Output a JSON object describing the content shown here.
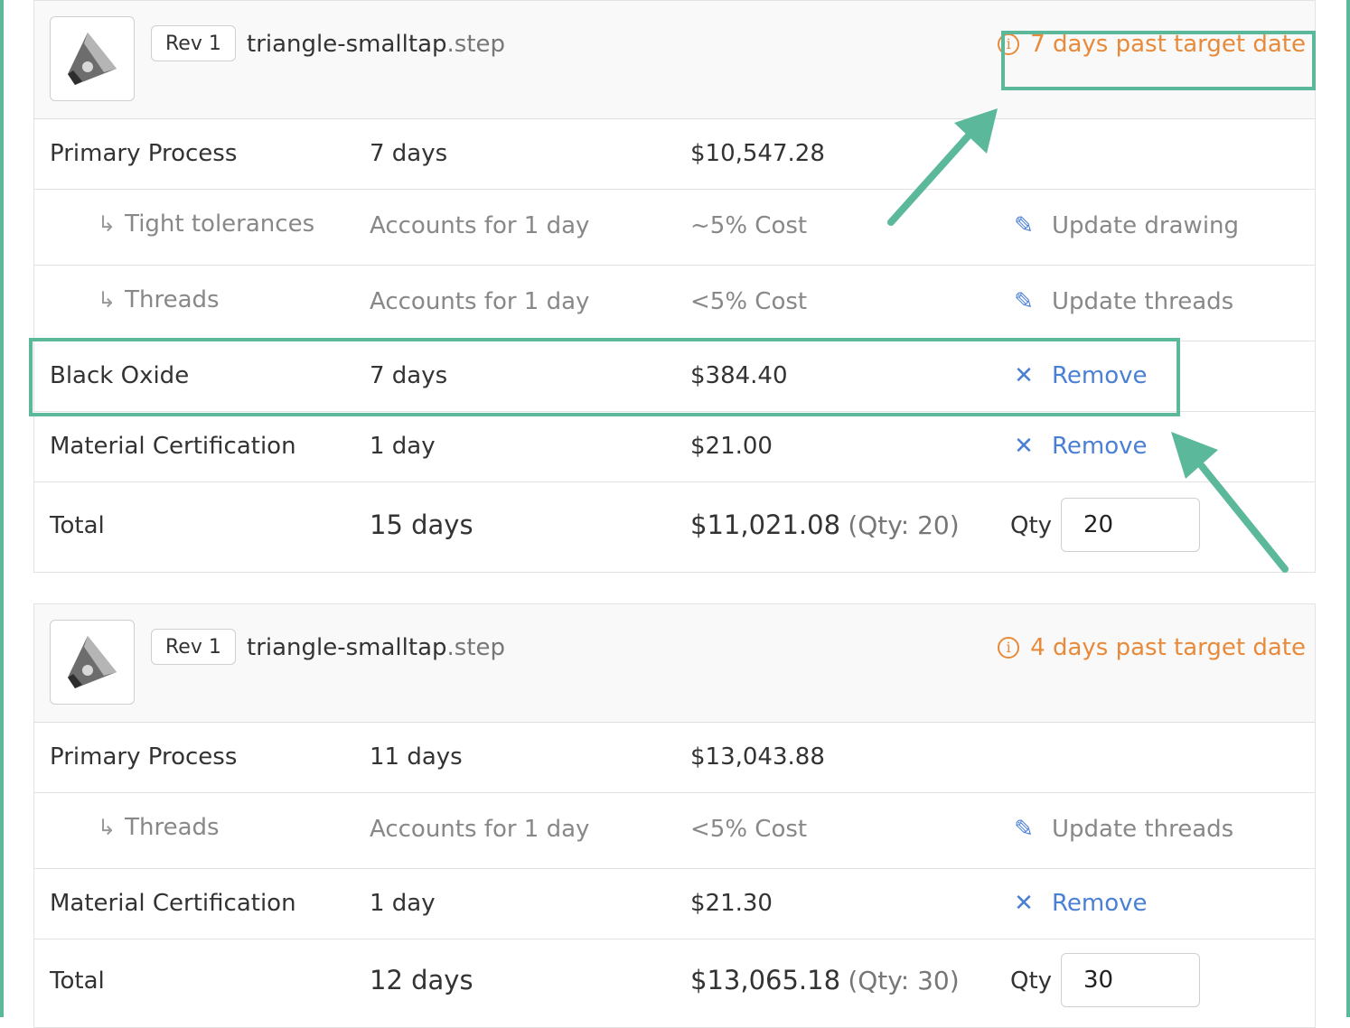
{
  "colors": {
    "accent": "#5bb89a",
    "warning": "#e98a3a",
    "link": "#4a7fd6"
  },
  "parts": [
    {
      "rev": "Rev 1",
      "filename_base": "triangle-smalltap",
      "filename_ext": ".step",
      "warning": "7 days past target date",
      "primary": {
        "label": "Primary Process",
        "days": "7 days",
        "cost": "$10,547.28"
      },
      "subs": [
        {
          "label": "Tight tolerances",
          "days": "Accounts for 1 day",
          "cost": "~5% Cost",
          "action": "Update drawing"
        },
        {
          "label": "Threads",
          "days": "Accounts for 1 day",
          "cost": "<5% Cost",
          "action": "Update threads"
        }
      ],
      "extras": [
        {
          "label": "Black Oxide",
          "days": "7 days",
          "cost": "$384.40",
          "action": "Remove"
        },
        {
          "label": "Material Certification",
          "days": "1 day",
          "cost": "$21.00",
          "action": "Remove"
        }
      ],
      "total": {
        "label": "Total",
        "days": "15 days",
        "cost": "$11,021.08",
        "qty_note": "(Qty: 20)",
        "qty_label": "Qty",
        "qty_value": "20"
      }
    },
    {
      "rev": "Rev 1",
      "filename_base": "triangle-smalltap",
      "filename_ext": ".step",
      "warning": "4 days past target date",
      "primary": {
        "label": "Primary Process",
        "days": "11 days",
        "cost": "$13,043.88"
      },
      "subs": [
        {
          "label": "Threads",
          "days": "Accounts for 1 day",
          "cost": "<5% Cost",
          "action": "Update threads"
        }
      ],
      "extras": [
        {
          "label": "Material Certification",
          "days": "1 day",
          "cost": "$21.30",
          "action": "Remove"
        }
      ],
      "total": {
        "label": "Total",
        "days": "12 days",
        "cost": "$13,065.18",
        "qty_note": "(Qty: 30)",
        "qty_label": "Qty",
        "qty_value": "30"
      }
    }
  ],
  "icons": {
    "sub": "sub-arrow-icon",
    "edit": "pencil-icon",
    "remove": "close-icon",
    "warning": "info-icon",
    "thumbnail": "part-thumbnail-icon"
  }
}
